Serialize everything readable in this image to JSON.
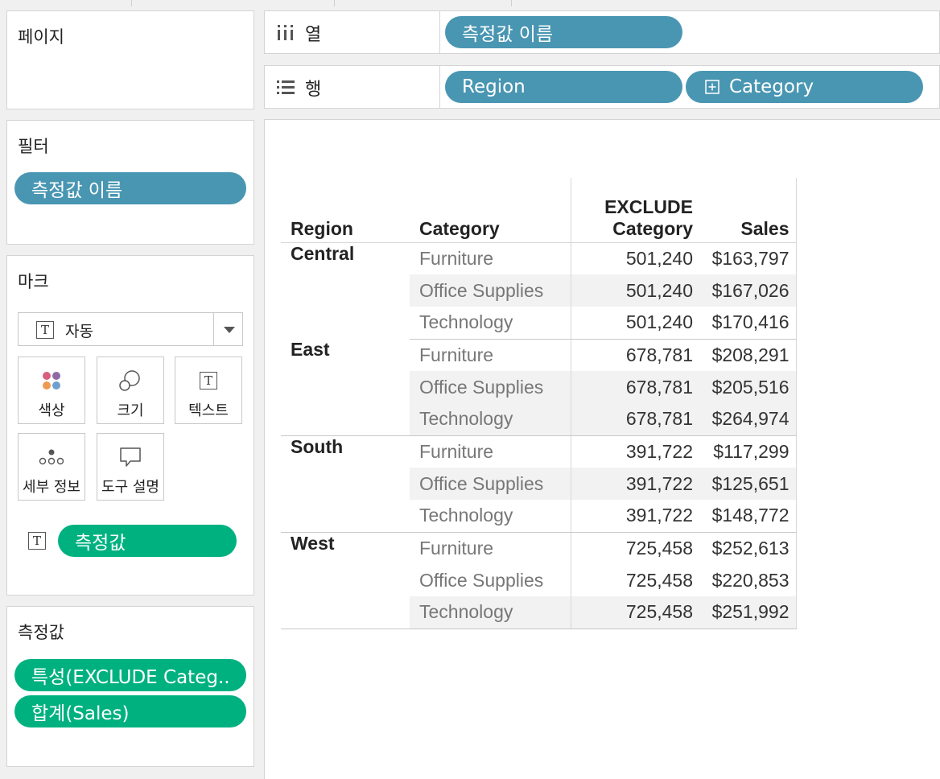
{
  "shelves": {
    "columns": {
      "label": "열",
      "icon": "columns-shelf-icon",
      "pills": [
        "측정값 이름"
      ]
    },
    "rows": {
      "label": "행",
      "icon": "rows-shelf-icon",
      "pills": [
        "Region",
        "Category"
      ]
    }
  },
  "pages": {
    "title": "페이지"
  },
  "filters": {
    "title": "필터",
    "pills": [
      "측정값 이름"
    ]
  },
  "marks": {
    "title": "마크",
    "mark_type": "자동",
    "buttons": [
      {
        "label": "색상",
        "icon": "color-dots-icon"
      },
      {
        "label": "크기",
        "icon": "size-circles-icon"
      },
      {
        "label": "텍스트",
        "icon": "text-t-icon"
      },
      {
        "label": "세부 정보",
        "icon": "detail-dots-icon"
      },
      {
        "label": "도구 설명",
        "icon": "tooltip-bubble-icon"
      }
    ],
    "pill": "측정값"
  },
  "measure_values": {
    "title": "측정값",
    "pills": [
      "특성(EXCLUDE Categ..",
      "합계(Sales)"
    ]
  },
  "colors": {
    "dimension_pill": "#4996b2",
    "measure_pill": "#00b180"
  },
  "table": {
    "headers": {
      "region": "Region",
      "category": "Category",
      "exclude_line1": "EXCLUDE",
      "exclude_line2": "Category",
      "sales": "Sales"
    },
    "rows": [
      {
        "region": "Central",
        "category": "Furniture",
        "exclude": "501,240",
        "sales": "$163,797"
      },
      {
        "region": "",
        "category": "Office Supplies",
        "exclude": "501,240",
        "sales": "$167,026"
      },
      {
        "region": "",
        "category": "Technology",
        "exclude": "501,240",
        "sales": "$170,416"
      },
      {
        "region": "East",
        "category": "Furniture",
        "exclude": "678,781",
        "sales": "$208,291"
      },
      {
        "region": "",
        "category": "Office Supplies",
        "exclude": "678,781",
        "sales": "$205,516"
      },
      {
        "region": "",
        "category": "Technology",
        "exclude": "678,781",
        "sales": "$264,974"
      },
      {
        "region": "South",
        "category": "Furniture",
        "exclude": "391,722",
        "sales": "$117,299"
      },
      {
        "region": "",
        "category": "Office Supplies",
        "exclude": "391,722",
        "sales": "$125,651"
      },
      {
        "region": "",
        "category": "Technology",
        "exclude": "391,722",
        "sales": "$148,772"
      },
      {
        "region": "West",
        "category": "Furniture",
        "exclude": "725,458",
        "sales": "$252,613"
      },
      {
        "region": "",
        "category": "Office Supplies",
        "exclude": "725,458",
        "sales": "$220,853"
      },
      {
        "region": "",
        "category": "Technology",
        "exclude": "725,458",
        "sales": "$251,992"
      }
    ]
  }
}
